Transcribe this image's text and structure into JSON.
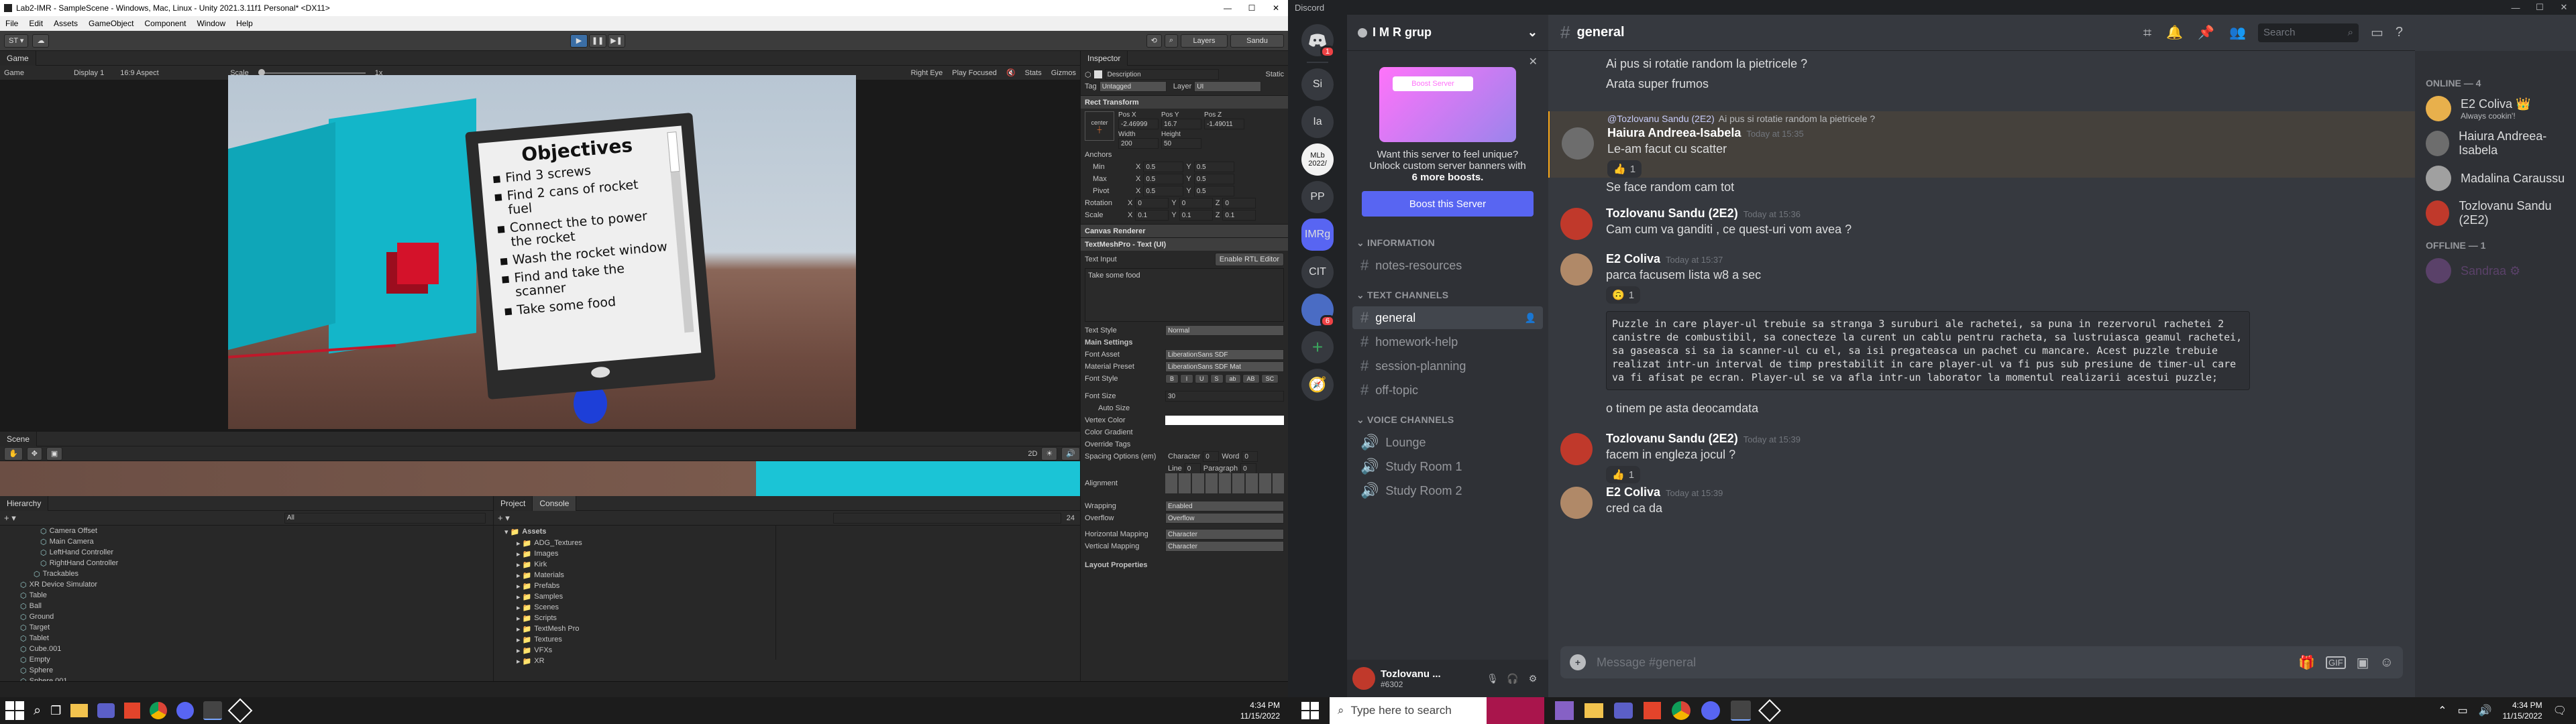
{
  "unity": {
    "title": "Lab2-IMR - SampleScene - Windows, Mac, Linux - Unity 2021.3.11f1 Personal* <DX11>",
    "menu": [
      "File",
      "Edit",
      "Assets",
      "GameObject",
      "Component",
      "Window",
      "Help"
    ],
    "toolbar": {
      "account": "ST ▾",
      "layers": "Layers",
      "layout": "Sandu"
    },
    "game_tab": "Game",
    "game_bar": {
      "mode": "Game",
      "display": "Display 1",
      "aspect": "16:9 Aspect",
      "scale_label": "Scale",
      "scale_value": "1x",
      "eye": "Right Eye",
      "play_focused": "Play Focused",
      "stats": "Stats",
      "gizmos": "Gizmos"
    },
    "scene_tab": "Scene",
    "scene_mode": "2D",
    "objectives": {
      "title": "Objectives",
      "items": [
        "Find 3 screws",
        "Find 2 cans of rocket fuel",
        "Connect the to power the rocket",
        "Wash the rocket window",
        "Find and take the scanner",
        "Take some food"
      ]
    },
    "hierarchy": {
      "tab": "Hierarchy",
      "search_placeholder": "All",
      "items": [
        "Camera Offset",
        "Main Camera",
        "LeftHand Controller",
        "RightHand Controller",
        "Trackables",
        "XR Device Simulator",
        "Table",
        "Ball",
        "Ground",
        "Target",
        "Tablet",
        "Cube.001",
        "Empty",
        "Sphere",
        "Sphere.001"
      ]
    },
    "project": {
      "tabs": [
        "Project",
        "Console"
      ],
      "favorites": "Assets",
      "items": [
        "ADG_Textures",
        "Images",
        "Kirk",
        "Materials",
        "Prefabs",
        "Samples",
        "Scenes",
        "Scripts",
        "TextMesh Pro",
        "Textures",
        "VFXs",
        "XR"
      ],
      "count": "24"
    },
    "inspector": {
      "tab": "Inspector",
      "object_name": "Description",
      "static_label": "Static",
      "tag_label": "Tag",
      "tag_value": "Untagged",
      "layer_label": "Layer",
      "layer_value": "UI",
      "rect_transform": "Rect Transform",
      "anchor": "center",
      "pos_labels": [
        "Pos X",
        "Pos Y",
        "Pos Z"
      ],
      "pos_values": [
        "-2.46999",
        "16.7",
        "-1.49011"
      ],
      "size_labels": [
        "Width",
        "Height"
      ],
      "size_values": [
        "200",
        "50"
      ],
      "anchors_label": "Anchors",
      "anchor_rows": [
        {
          "label": "Min",
          "x": "0.5",
          "y": "0.5"
        },
        {
          "label": "Max",
          "x": "0.5",
          "y": "0.5"
        },
        {
          "label": "Pivot",
          "x": "0.5",
          "y": "0.5"
        }
      ],
      "rotation": {
        "label": "Rotation",
        "x": "0",
        "y": "0",
        "z": "0"
      },
      "scale": {
        "label": "Scale",
        "x": "0.1",
        "y": "0.1",
        "z": "0.1"
      },
      "canvas_renderer": "Canvas Renderer",
      "tmp": "TextMeshPro - Text (UI)",
      "text_input": "Text Input",
      "rtl": "Enable RTL Editor",
      "text_value": "Take some food",
      "text_style_label": "Text Style",
      "text_style": "Normal",
      "main_settings": "Main Settings",
      "font_asset_label": "Font Asset",
      "font_asset": "LiberationSans SDF",
      "material_label": "Material Preset",
      "material": "LiberationSans SDF Mat",
      "font_style_label": "Font Style",
      "font_style_buttons": [
        "B",
        "I",
        "U",
        "S",
        "ab",
        "AB",
        "SC"
      ],
      "font_size_label": "Font Size",
      "font_size": "30",
      "auto_size": "Auto Size",
      "vertex_color": "Vertex Color",
      "color_gradient": "Color Gradient",
      "override_tags": "Override Tags",
      "spacing_label": "Spacing Options (em)",
      "spacing": {
        "char_label": "Character",
        "char": "0",
        "word_label": "Word",
        "word": "0",
        "line_label": "Line",
        "line": "0",
        "para_label": "Paragraph",
        "para": "0"
      },
      "alignment_label": "Alignment",
      "wrapping_label": "Wrapping",
      "wrapping": "Enabled",
      "overflow_label": "Overflow",
      "overflow": "Overflow",
      "hmap_label": "Horizontal Mapping",
      "hmap": "Character",
      "vmap_label": "Vertical Mapping",
      "vmap": "Character",
      "layout_props": "Layout Properties"
    }
  },
  "discord": {
    "app_title": "Discord",
    "servers": [
      {
        "label": "Si",
        "color": "#36393f"
      },
      {
        "label": "Ia",
        "color": "#36393f"
      },
      {
        "label": "MLb 2022/",
        "color": "#f2f2f2"
      },
      {
        "label": "PP",
        "color": "#36393f"
      },
      {
        "label": "IMRg",
        "color": "#5865f2"
      },
      {
        "label": "CIT",
        "color": "#36393f"
      }
    ],
    "home_badge": "1",
    "server_badge": "6",
    "server_name": "I M R grup",
    "boost": {
      "banner_text": "Boost Server",
      "text1": "Want this server to feel unique?",
      "text2": "Unlock custom server banners with",
      "text3": "6 more boosts.",
      "button": "Boost this Server"
    },
    "categories": {
      "information": "INFORMATION",
      "text": "TEXT CHANNELS",
      "voice": "VOICE CHANNELS"
    },
    "info_channels": [
      "notes-resources"
    ],
    "text_channels": [
      "general",
      "homework-help",
      "session-planning",
      "off-topic"
    ],
    "voice_channels": [
      "Lounge",
      "Study Room 1",
      "Study Room 2"
    ],
    "user": {
      "name": "Tozlovanu ...",
      "tag": "#6302"
    },
    "channel_title": "general",
    "search_placeholder": "Search",
    "messages": [
      {
        "type": "cont",
        "text": "Ai pus si rotatie random la pietricele ?"
      },
      {
        "type": "cont",
        "text": "Arata super frumos"
      },
      {
        "type": "reply",
        "reply_to": "@Tozlovanu Sandu (2E2)",
        "reply_text": "Ai pus si rotatie random la pietricele ?",
        "author": "Haiura Andreea-Isabela",
        "time": "Today at 15:35",
        "text": "Le-am facut cu scatter",
        "reaction": "👍",
        "reaction_count": "1"
      },
      {
        "type": "cont",
        "text": "Se face random cam tot"
      },
      {
        "type": "msg",
        "author": "Tozlovanu Sandu (2E2)",
        "time": "Today at 15:36",
        "text": "Cam cum va ganditi , ce quest-uri vom avea ?"
      },
      {
        "type": "msg",
        "author": "E2 Coliva",
        "time": "Today at 15:37",
        "text": "parca facusem lista w8 a sec",
        "reaction": "🙃",
        "reaction_count": "1"
      },
      {
        "type": "code",
        "text": "Puzzle in care player-ul trebuie sa stranga 3 suruburi ale rachetei, sa puna in rezervorul rachetei 2 canistre de combustibil, sa conecteze la curent un cablu pentru racheta, sa lustruiasca geamul rachetei, sa gaseasca si sa ia scanner-ul cu el, sa isi pregateasca un pachet cu mancare. Acest puzzle trebuie realizat intr-un interval de timp prestabilit in care player-ul va fi pus sub presiune de timer-ul care va fi afisat pe ecran. Player-ul se va afla intr-un laborator la momentul realizarii acestui puzzle;"
      },
      {
        "type": "cont",
        "text": "o tinem pe asta deocamdata"
      },
      {
        "type": "msg",
        "author": "Tozlovanu Sandu (2E2)",
        "time": "Today at 15:39",
        "text": "facem in engleza jocul ?",
        "reaction": "👍",
        "reaction_count": "1"
      },
      {
        "type": "msg",
        "author": "E2 Coliva",
        "time": "Today at 15:39",
        "text": "cred ca da"
      }
    ],
    "input_placeholder": "Message #general",
    "online_header": "ONLINE — 4",
    "offline_header": "OFFLINE — 1",
    "members_online": [
      {
        "name": "E2 Coliva 👑",
        "status": "Always cookin'!",
        "color": "#e8b04c"
      },
      {
        "name": "Haiura Andreea-Isabela",
        "status": "",
        "color": "#6d6d6d"
      },
      {
        "name": "Madalina Caraussu",
        "status": "",
        "color": "#a0a0a0"
      },
      {
        "name": "Tozlovanu Sandu (2E2)",
        "status": "",
        "color": "#c0392b"
      }
    ],
    "members_offline": [
      {
        "name": "Sandraa ⚙",
        "color": "#9b59b6"
      }
    ]
  },
  "taskbar": {
    "search_placeholder": "Type here to search",
    "time": "4:34 PM",
    "date": "11/15/2022",
    "time_left": "4:34 PM",
    "date_left": "11/15/2022"
  }
}
